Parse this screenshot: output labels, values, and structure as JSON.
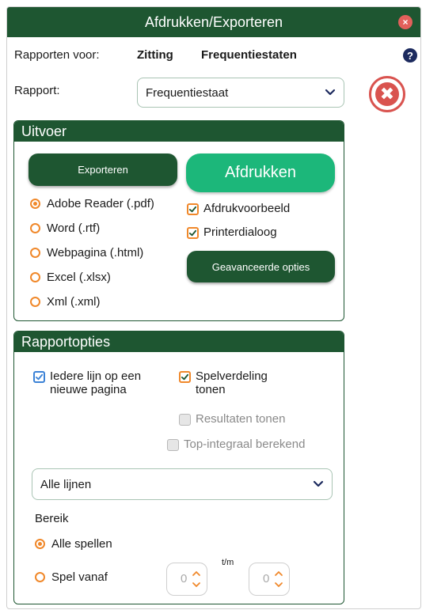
{
  "window": {
    "title": "Afdrukken/Exporteren",
    "close_glyph": "×"
  },
  "header": {
    "reports_for_label": "Rapporten voor:",
    "session_label": "Zitting",
    "frequency_label": "Frequentiestaten",
    "help_glyph": "?"
  },
  "report": {
    "label": "Rapport:",
    "selected": "Frequentiestaat",
    "cancel_glyph": "✖"
  },
  "output": {
    "title": "Uitvoer",
    "export_button": "Exporteren",
    "print_button": "Afdrukken",
    "advanced_button": "Geavanceerde opties",
    "formats": [
      {
        "label": "Adobe Reader (.pdf)",
        "selected": true
      },
      {
        "label": "Word (.rtf)",
        "selected": false
      },
      {
        "label": "Webpagina (.html)",
        "selected": false
      },
      {
        "label": "Excel (.xlsx)",
        "selected": false
      },
      {
        "label": "Xml (.xml)",
        "selected": false
      }
    ],
    "preview_label": "Afdrukvoorbeeld",
    "preview_checked": true,
    "printer_dialog_label": "Printerdialoog",
    "printer_dialog_checked": true
  },
  "options": {
    "title": "Rapportopties",
    "each_line_label_1": "Iedere lijn op een",
    "each_line_label_2": "nieuwe pagina",
    "each_line_checked": true,
    "game_distribution_label_1": "Spelverdeling",
    "game_distribution_label_2": "tonen",
    "game_distribution_checked": true,
    "show_results_label": "Resultaten tonen",
    "show_results_checked": false,
    "top_integral_label": "Top-integraal berekend",
    "top_integral_checked": false,
    "lines_selected": "Alle lijnen",
    "range_label": "Bereik",
    "all_games_label": "Alle spellen",
    "all_games_selected": true,
    "game_from_label": "Spel vanaf",
    "game_from_selected": false,
    "from_value": "0",
    "to_label": "t/m",
    "to_value": "0"
  },
  "colors": {
    "header_green": "#1e5631",
    "print_green": "#1cb77a",
    "radio_orange": "#f0882a",
    "check_blue": "#3b82d6",
    "cancel_red": "#d9534f"
  }
}
